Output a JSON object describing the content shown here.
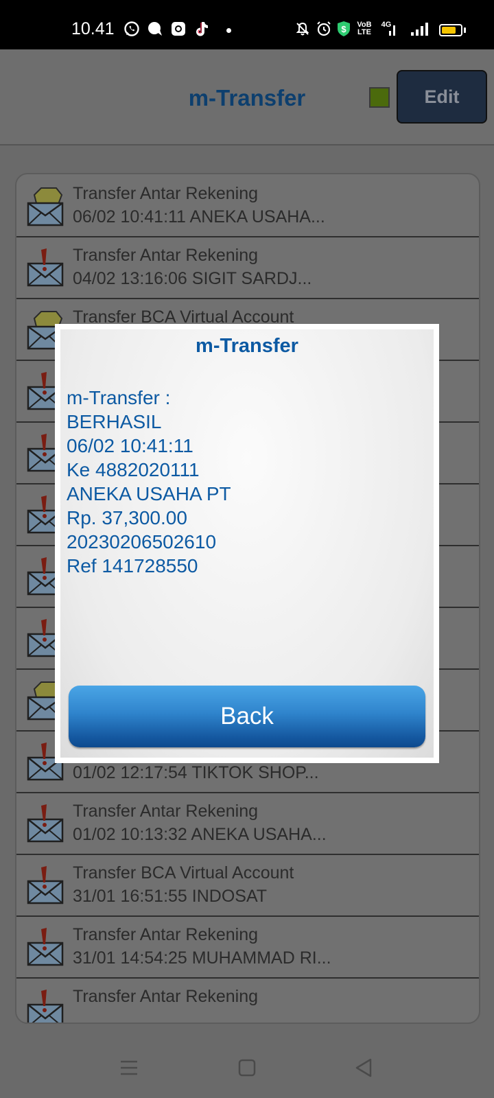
{
  "status_bar": {
    "time": "10.41",
    "icons": [
      "whatsapp-icon",
      "chat-bubble-icon",
      "instagram-icon",
      "tiktok-icon",
      "dot-icon",
      "mute-icon",
      "alarm-icon",
      "shield-icon",
      "volte-icon",
      "4g-signal-icon",
      "cell-signal-icon",
      "battery-icon"
    ],
    "volte_text": "VoB LTE",
    "network_text": "4G",
    "battery_level": 0.75,
    "battery_color": "#f5c400"
  },
  "header": {
    "title": "m-Transfer",
    "edit_label": "Edit",
    "status_color": "#4b6a0c"
  },
  "list": {
    "items": [
      {
        "title": "Transfer Antar Rekening",
        "subtitle": "06/02 10:41:11 ANEKA USAHA...",
        "icon": "open-envelope-icon"
      },
      {
        "title": "Transfer Antar Rekening",
        "subtitle": "04/02 13:16:06 SIGIT SARDJ...",
        "icon": "envelope-alert-icon"
      },
      {
        "title": "Transfer BCA Virtual Account",
        "subtitle": "",
        "icon": "open-envelope-icon"
      },
      {
        "title": "",
        "subtitle": "",
        "icon": "envelope-alert-icon"
      },
      {
        "title": "",
        "subtitle": "",
        "icon": "envelope-alert-icon"
      },
      {
        "title": "",
        "subtitle": "",
        "icon": "envelope-alert-icon"
      },
      {
        "title": "",
        "subtitle": "",
        "icon": "envelope-alert-icon"
      },
      {
        "title": "",
        "subtitle": "",
        "icon": "envelope-alert-icon"
      },
      {
        "title": "",
        "subtitle": "",
        "icon": "open-envelope-icon"
      },
      {
        "title": "Transfer BCA Virtual Account",
        "subtitle": "01/02 12:17:54 TIKTOK SHOP...",
        "icon": "envelope-alert-icon"
      },
      {
        "title": "Transfer Antar Rekening",
        "subtitle": "01/02 10:13:32 ANEKA USAHA...",
        "icon": "envelope-alert-icon"
      },
      {
        "title": "Transfer BCA Virtual Account",
        "subtitle": "31/01 16:51:55 INDOSAT",
        "icon": "envelope-alert-icon"
      },
      {
        "title": "Transfer Antar Rekening",
        "subtitle": "31/01 14:54:25 MUHAMMAD RI...",
        "icon": "envelope-alert-icon"
      },
      {
        "title": "Transfer Antar Rekening",
        "subtitle": "",
        "icon": "envelope-alert-icon"
      }
    ]
  },
  "dialog": {
    "title": "m-Transfer",
    "lines": [
      "m-Transfer :",
      "BERHASIL",
      "06/02 10:41:11",
      "Ke 4882020111",
      "ANEKA USAHA PT",
      "Rp. 37,300.00",
      "20230206502610",
      "Ref 141728550"
    ],
    "back_label": "Back"
  },
  "nav": {
    "buttons": [
      "menu-icon",
      "home-icon",
      "back-icon"
    ]
  }
}
